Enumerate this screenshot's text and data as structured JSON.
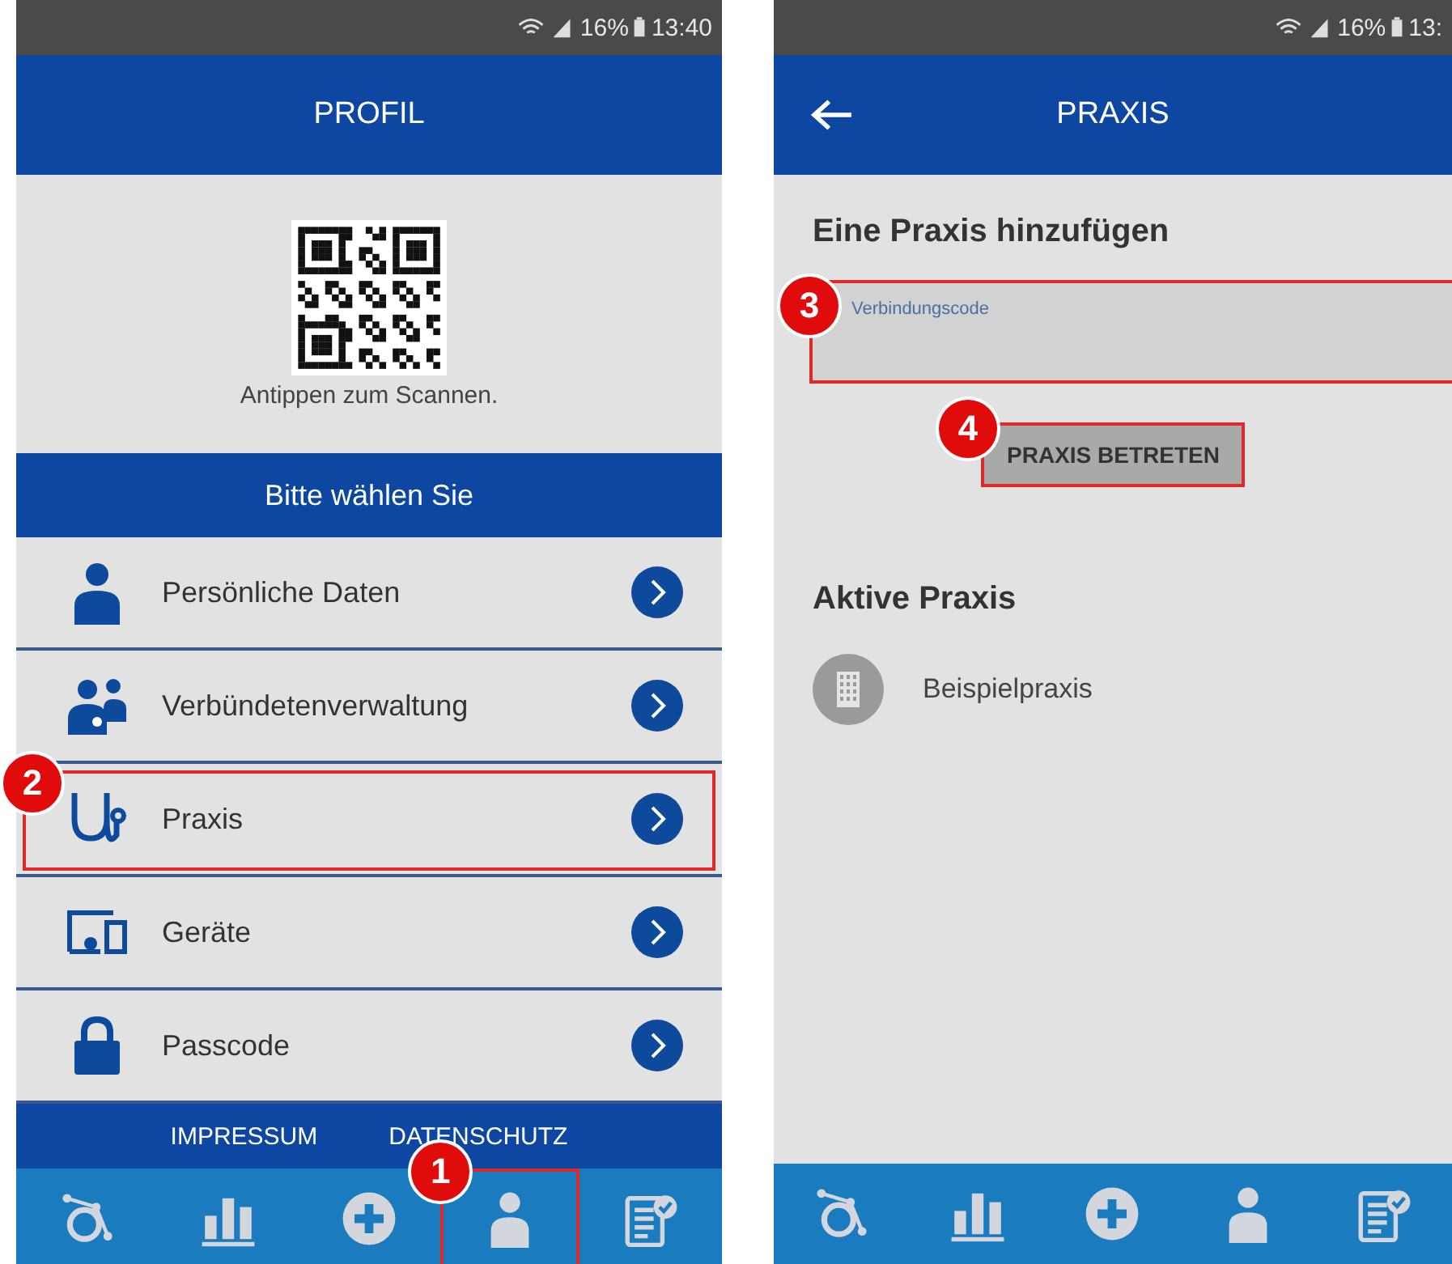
{
  "screens": [
    {
      "kind": "profile",
      "status_bar": {
        "battery": "16%",
        "time": "13:40"
      },
      "header": {
        "title": "PROFIL",
        "back": false
      },
      "qr_caption": "Antippen zum Scannen.",
      "section_title": "Bitte wählen Sie",
      "menu": [
        {
          "label": "Persönliche Daten",
          "kind": "person"
        },
        {
          "label": "Verbündetenverwaltung",
          "kind": "group"
        },
        {
          "label": "Praxis",
          "kind": "stethoscope",
          "callout": "2"
        },
        {
          "label": "Geräte",
          "kind": "devices"
        },
        {
          "label": "Passcode",
          "kind": "lock"
        }
      ],
      "footer_links": [
        "IMPRESSUM",
        "DATENSCHUTZ"
      ],
      "nav": [
        {
          "kind": "wheelchair"
        },
        {
          "kind": "chart"
        },
        {
          "kind": "plus"
        },
        {
          "kind": "person",
          "callout": "1"
        },
        {
          "kind": "checklist"
        }
      ]
    },
    {
      "kind": "praxis",
      "status_bar": {
        "battery": "16%",
        "time": "13:"
      },
      "header": {
        "title": "PRAXIS",
        "back": true
      },
      "add_title": "Eine Praxis hinzufügen",
      "field": {
        "placeholder": "Verbindungscode",
        "callout": "3"
      },
      "button": {
        "label": "PRAXIS BETRETEN",
        "callout": "4"
      },
      "active_title": "Aktive Praxis",
      "practices": [
        {
          "name": "Beispielpraxis"
        }
      ],
      "nav": [
        {
          "kind": "wheelchair"
        },
        {
          "kind": "chart"
        },
        {
          "kind": "plus"
        },
        {
          "kind": "person"
        },
        {
          "kind": "checklist"
        }
      ]
    }
  ]
}
